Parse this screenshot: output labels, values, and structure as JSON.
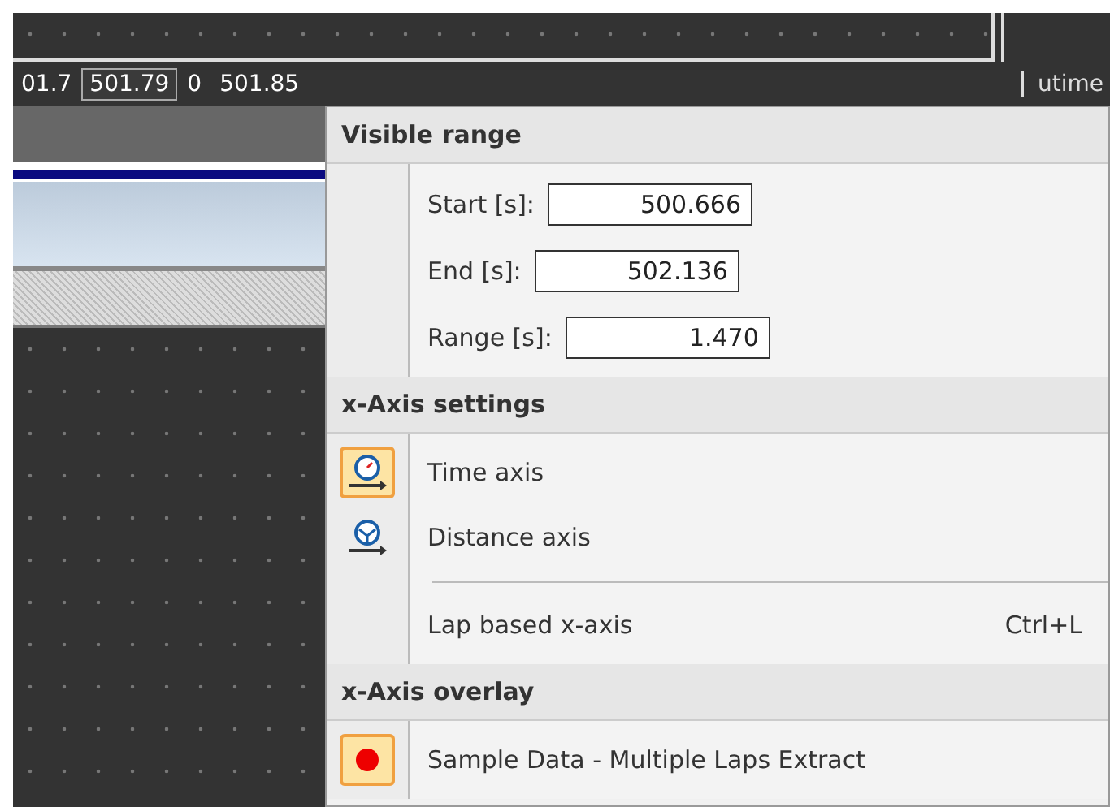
{
  "axis": {
    "labels": [
      {
        "text": "01.7",
        "selected": false
      },
      {
        "text": "501.79",
        "selected": true
      },
      {
        "text": "0",
        "selected": false
      },
      {
        "text": "501.85",
        "selected": false
      }
    ],
    "side_label": "utime"
  },
  "menu": {
    "sections": [
      {
        "title": "Visible range",
        "items": [
          {
            "kind": "field",
            "label": "Start [s]:",
            "value": "500.666"
          },
          {
            "kind": "field",
            "label": "End [s]:",
            "value": "502.136"
          },
          {
            "kind": "field",
            "label": "Range [s]:",
            "value": "1.470"
          }
        ]
      },
      {
        "title": "x-Axis settings",
        "items": [
          {
            "kind": "option",
            "label": "Time axis",
            "checked": true
          },
          {
            "kind": "option",
            "label": "Distance axis",
            "checked": false
          },
          {
            "kind": "separator"
          },
          {
            "kind": "option",
            "label": "Lap based x-axis",
            "shortcut": "Ctrl+L",
            "checked": false
          }
        ]
      },
      {
        "title": "x-Axis overlay",
        "items": [
          {
            "kind": "option",
            "label": "Sample Data - Multiple Laps Extract",
            "checked": true
          }
        ]
      }
    ]
  }
}
